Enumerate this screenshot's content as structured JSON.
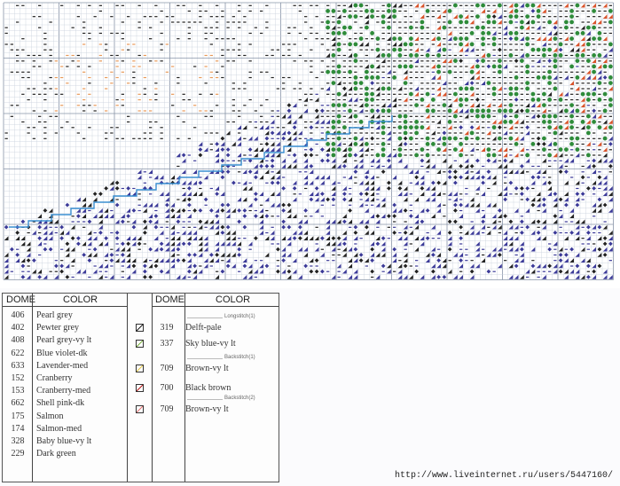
{
  "key_left": {
    "headers": {
      "code": "DOME",
      "color": "COLOR"
    },
    "rows": [
      {
        "code": "406",
        "name": "Pearl grey"
      },
      {
        "code": "402",
        "name": "Pewter grey"
      },
      {
        "code": "408",
        "name": "Pearl grey-vy lt"
      },
      {
        "code": "622",
        "name": "Blue violet-dk"
      },
      {
        "code": "633",
        "name": "Lavender-med"
      },
      {
        "code": "152",
        "name": "Cranberry"
      },
      {
        "code": "153",
        "name": "Cranberry-med"
      },
      {
        "code": "662",
        "name": "Shell pink-dk"
      },
      {
        "code": "175",
        "name": "Salmon"
      },
      {
        "code": "174",
        "name": "Salmon-med"
      },
      {
        "code": "328",
        "name": "Baby blue-vy lt"
      },
      {
        "code": "229",
        "name": "Dark green"
      }
    ]
  },
  "key_right": {
    "headers": {
      "code": "DOME",
      "color": "COLOR"
    },
    "sections": {
      "longstitch": "Longstitch(1)",
      "backstitch1": "Backstitch(1)",
      "backstitch2": "Backstitch(2)"
    },
    "rows": [
      {
        "code": "319",
        "name": "Delft-pale",
        "swatch": "#222222"
      },
      {
        "code": "337",
        "name": "Sky blue-vy lt",
        "swatch": "#7cb342"
      },
      {
        "code": "709",
        "name": "Brown-vy lt",
        "swatch": "#e6c84a"
      },
      {
        "code": "700",
        "name": "Black brown",
        "swatch": "#b71c1c"
      },
      {
        "code": "709",
        "name": "Brown-vy lt",
        "swatch": "#e57373"
      }
    ]
  },
  "footer": {
    "url": "http://www.liveinternet.ru/users/5447160/"
  },
  "colors": {
    "grid_line": "#c8d0dc",
    "grid_major": "#8894a8",
    "blue_violet": "#3b3a98",
    "green": "#2e8b3a",
    "red": "#d9532b",
    "orange": "#e89a5a",
    "black": "#222222",
    "stitch_line": "#3a8fd1"
  }
}
